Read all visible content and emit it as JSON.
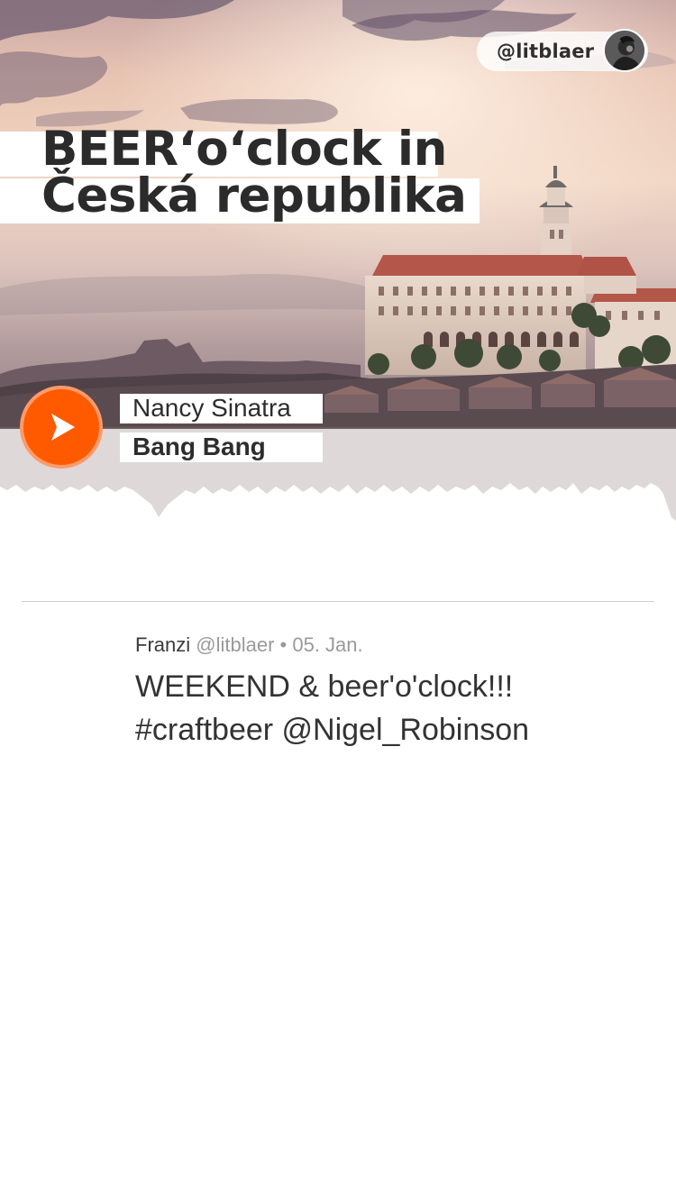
{
  "user": {
    "handle": "@litblaer"
  },
  "headline": {
    "line1": "BEER‘o‘clock in",
    "line2": "Česká republika"
  },
  "player": {
    "artist": "Nancy Sinatra",
    "title": "Bang Bang",
    "play_icon": "play-icon"
  },
  "post": {
    "author": "Franzi",
    "handle": "@litblaer",
    "separator": "•",
    "date": "05. Jan.",
    "text_line1": "WEEKEND & beer'o'clock!!!",
    "text_line2": "#craftbeer @Nigel_Robinson"
  },
  "colors": {
    "accent": "#ff5a00",
    "text": "#2b2b2b",
    "muted": "#9a9a9a"
  }
}
